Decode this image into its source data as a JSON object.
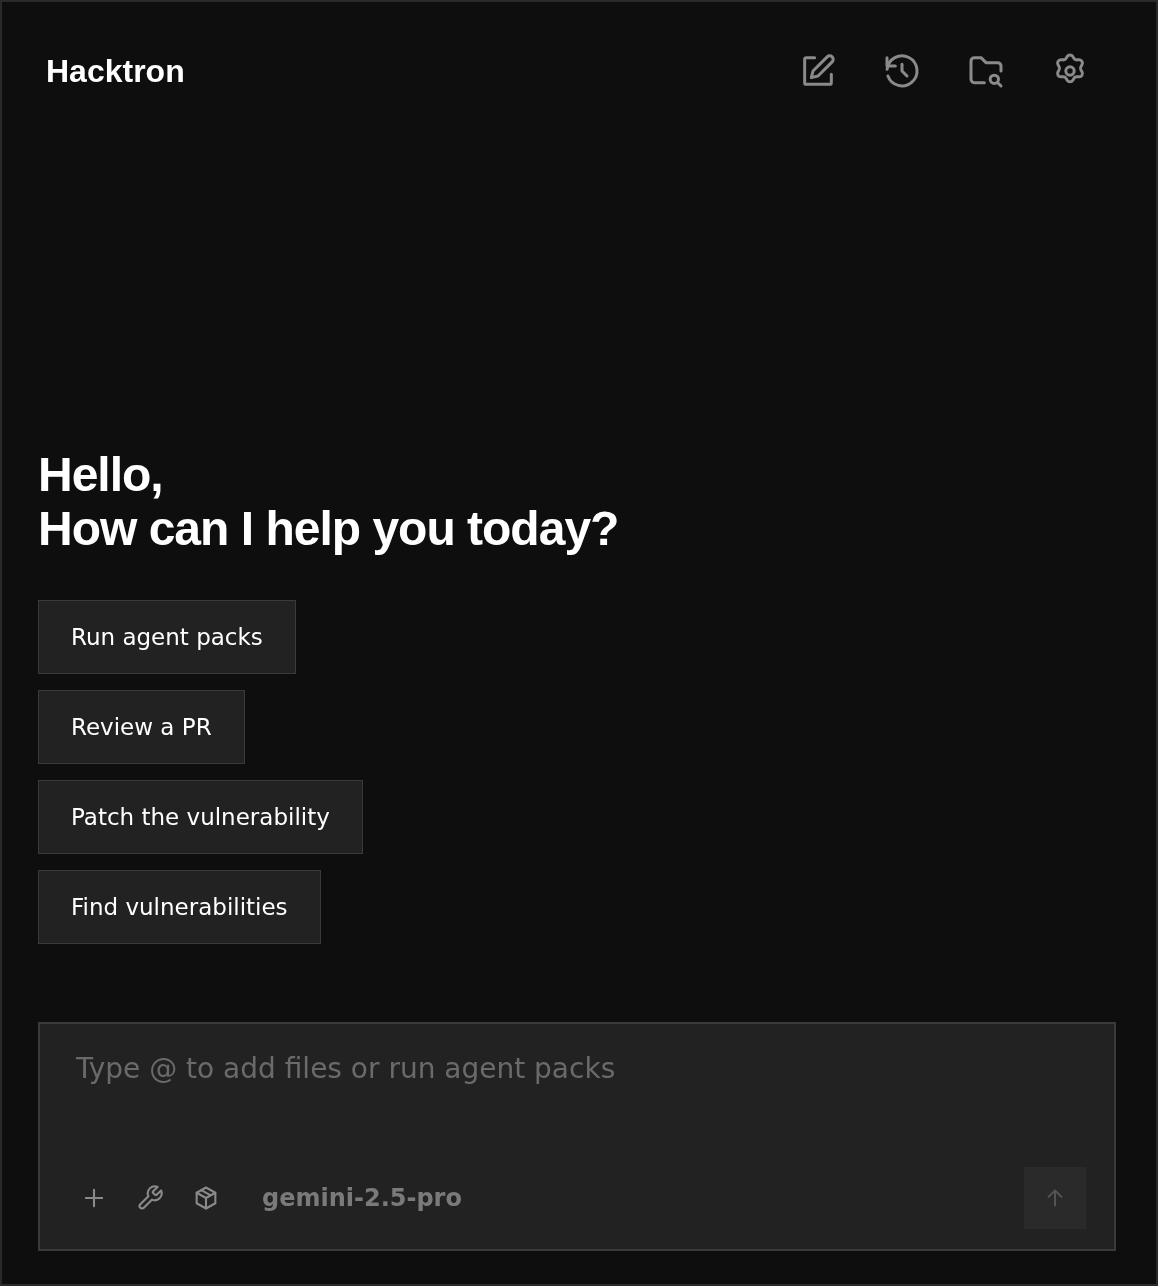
{
  "header": {
    "title": "Hacktron"
  },
  "greeting": {
    "line_1": "Hello,",
    "line_2": "How can I help you today?"
  },
  "suggestions": [
    "Run agent packs",
    "Review a PR",
    "Patch the vulnerability",
    "Find vulnerabilities"
  ],
  "composer": {
    "placeholder": "Type @ to add files or run agent packs",
    "model": "gemini-2.5-pro",
    "send_disabled": true
  }
}
